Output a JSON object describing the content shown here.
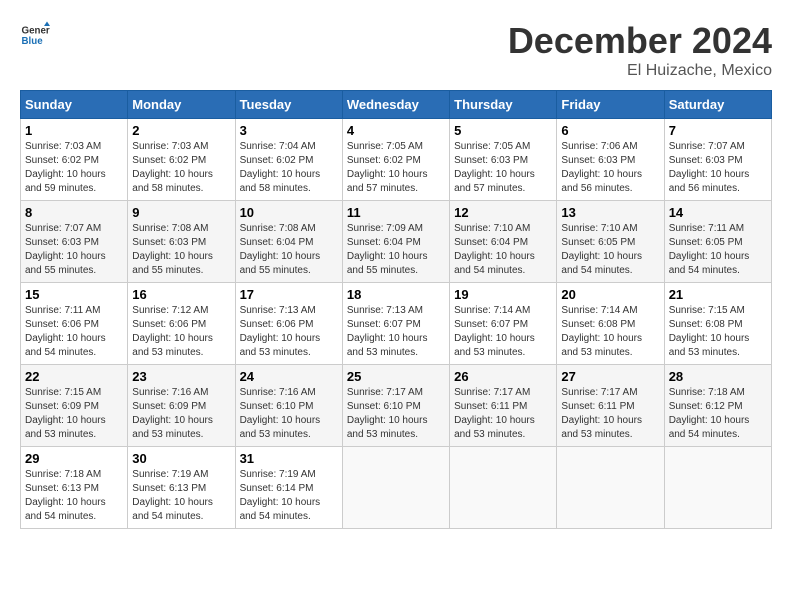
{
  "header": {
    "logo_line1": "General",
    "logo_line2": "Blue",
    "month": "December 2024",
    "location": "El Huizache, Mexico"
  },
  "weekdays": [
    "Sunday",
    "Monday",
    "Tuesday",
    "Wednesday",
    "Thursday",
    "Friday",
    "Saturday"
  ],
  "weeks": [
    [
      {
        "day": "1",
        "info": "Sunrise: 7:03 AM\nSunset: 6:02 PM\nDaylight: 10 hours\nand 59 minutes."
      },
      {
        "day": "2",
        "info": "Sunrise: 7:03 AM\nSunset: 6:02 PM\nDaylight: 10 hours\nand 58 minutes."
      },
      {
        "day": "3",
        "info": "Sunrise: 7:04 AM\nSunset: 6:02 PM\nDaylight: 10 hours\nand 58 minutes."
      },
      {
        "day": "4",
        "info": "Sunrise: 7:05 AM\nSunset: 6:02 PM\nDaylight: 10 hours\nand 57 minutes."
      },
      {
        "day": "5",
        "info": "Sunrise: 7:05 AM\nSunset: 6:03 PM\nDaylight: 10 hours\nand 57 minutes."
      },
      {
        "day": "6",
        "info": "Sunrise: 7:06 AM\nSunset: 6:03 PM\nDaylight: 10 hours\nand 56 minutes."
      },
      {
        "day": "7",
        "info": "Sunrise: 7:07 AM\nSunset: 6:03 PM\nDaylight: 10 hours\nand 56 minutes."
      }
    ],
    [
      {
        "day": "8",
        "info": "Sunrise: 7:07 AM\nSunset: 6:03 PM\nDaylight: 10 hours\nand 55 minutes."
      },
      {
        "day": "9",
        "info": "Sunrise: 7:08 AM\nSunset: 6:03 PM\nDaylight: 10 hours\nand 55 minutes."
      },
      {
        "day": "10",
        "info": "Sunrise: 7:08 AM\nSunset: 6:04 PM\nDaylight: 10 hours\nand 55 minutes."
      },
      {
        "day": "11",
        "info": "Sunrise: 7:09 AM\nSunset: 6:04 PM\nDaylight: 10 hours\nand 55 minutes."
      },
      {
        "day": "12",
        "info": "Sunrise: 7:10 AM\nSunset: 6:04 PM\nDaylight: 10 hours\nand 54 minutes."
      },
      {
        "day": "13",
        "info": "Sunrise: 7:10 AM\nSunset: 6:05 PM\nDaylight: 10 hours\nand 54 minutes."
      },
      {
        "day": "14",
        "info": "Sunrise: 7:11 AM\nSunset: 6:05 PM\nDaylight: 10 hours\nand 54 minutes."
      }
    ],
    [
      {
        "day": "15",
        "info": "Sunrise: 7:11 AM\nSunset: 6:06 PM\nDaylight: 10 hours\nand 54 minutes."
      },
      {
        "day": "16",
        "info": "Sunrise: 7:12 AM\nSunset: 6:06 PM\nDaylight: 10 hours\nand 53 minutes."
      },
      {
        "day": "17",
        "info": "Sunrise: 7:13 AM\nSunset: 6:06 PM\nDaylight: 10 hours\nand 53 minutes."
      },
      {
        "day": "18",
        "info": "Sunrise: 7:13 AM\nSunset: 6:07 PM\nDaylight: 10 hours\nand 53 minutes."
      },
      {
        "day": "19",
        "info": "Sunrise: 7:14 AM\nSunset: 6:07 PM\nDaylight: 10 hours\nand 53 minutes."
      },
      {
        "day": "20",
        "info": "Sunrise: 7:14 AM\nSunset: 6:08 PM\nDaylight: 10 hours\nand 53 minutes."
      },
      {
        "day": "21",
        "info": "Sunrise: 7:15 AM\nSunset: 6:08 PM\nDaylight: 10 hours\nand 53 minutes."
      }
    ],
    [
      {
        "day": "22",
        "info": "Sunrise: 7:15 AM\nSunset: 6:09 PM\nDaylight: 10 hours\nand 53 minutes."
      },
      {
        "day": "23",
        "info": "Sunrise: 7:16 AM\nSunset: 6:09 PM\nDaylight: 10 hours\nand 53 minutes."
      },
      {
        "day": "24",
        "info": "Sunrise: 7:16 AM\nSunset: 6:10 PM\nDaylight: 10 hours\nand 53 minutes."
      },
      {
        "day": "25",
        "info": "Sunrise: 7:17 AM\nSunset: 6:10 PM\nDaylight: 10 hours\nand 53 minutes."
      },
      {
        "day": "26",
        "info": "Sunrise: 7:17 AM\nSunset: 6:11 PM\nDaylight: 10 hours\nand 53 minutes."
      },
      {
        "day": "27",
        "info": "Sunrise: 7:17 AM\nSunset: 6:11 PM\nDaylight: 10 hours\nand 53 minutes."
      },
      {
        "day": "28",
        "info": "Sunrise: 7:18 AM\nSunset: 6:12 PM\nDaylight: 10 hours\nand 54 minutes."
      }
    ],
    [
      {
        "day": "29",
        "info": "Sunrise: 7:18 AM\nSunset: 6:13 PM\nDaylight: 10 hours\nand 54 minutes."
      },
      {
        "day": "30",
        "info": "Sunrise: 7:19 AM\nSunset: 6:13 PM\nDaylight: 10 hours\nand 54 minutes."
      },
      {
        "day": "31",
        "info": "Sunrise: 7:19 AM\nSunset: 6:14 PM\nDaylight: 10 hours\nand 54 minutes."
      },
      {
        "day": "",
        "info": ""
      },
      {
        "day": "",
        "info": ""
      },
      {
        "day": "",
        "info": ""
      },
      {
        "day": "",
        "info": ""
      }
    ]
  ]
}
